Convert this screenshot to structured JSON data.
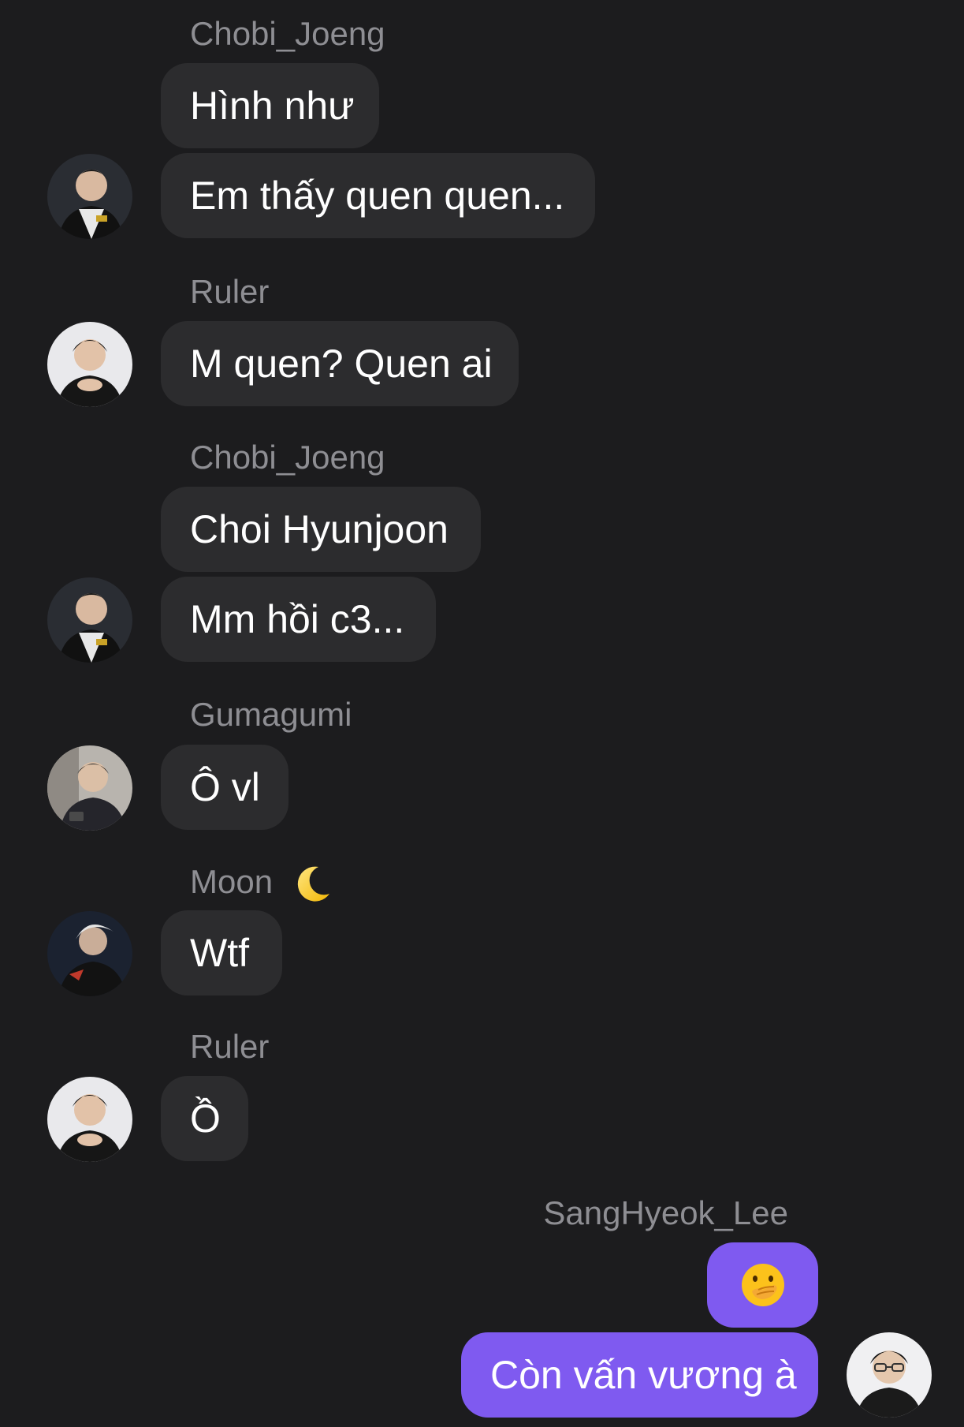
{
  "messages": [
    {
      "sender": "Chobi_Joeng",
      "bubbles": [
        "Hình như",
        "Em thấy quen quen..."
      ]
    },
    {
      "sender": "Ruler",
      "bubbles": [
        "M quen? Quen ai"
      ]
    },
    {
      "sender": "Chobi_Joeng",
      "bubbles": [
        "Choi Hyunjoon",
        "Mm hồi c3..."
      ]
    },
    {
      "sender": "Gumagumi",
      "bubbles": [
        "Ô vl"
      ]
    },
    {
      "sender": "Moon",
      "sender_emoji": "crescent-moon",
      "bubbles": [
        "Wtf"
      ]
    },
    {
      "sender": "Ruler",
      "bubbles": [
        "Ồ"
      ]
    },
    {
      "sender": "SangHyeok_Lee",
      "is_me": true,
      "bubbles": [
        "face-with-hand-over-mouth-emoji",
        "Còn vấn vương à"
      ]
    }
  ],
  "colors": {
    "background": "#1c1c1e",
    "incoming_bubble": "#2c2c2e",
    "outgoing_bubble": "#7f5af0",
    "sender_text": "#8e8e93",
    "message_text": "#ffffff"
  }
}
